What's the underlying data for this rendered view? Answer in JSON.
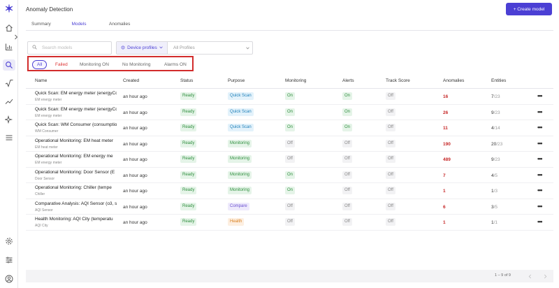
{
  "header": {
    "title": "Anomaly Detection",
    "create_label": "+ Create model"
  },
  "tabs": [
    {
      "label": "Summary"
    },
    {
      "label": "Models"
    },
    {
      "label": "Anomalies"
    }
  ],
  "search": {
    "placeholder": "Search models",
    "value": ""
  },
  "profile_filter": {
    "type_label": "Device profiles",
    "value": "All Profiles"
  },
  "status_filters": [
    {
      "label": "All"
    },
    {
      "label": "Failed"
    },
    {
      "label": "Monitoring ON"
    },
    {
      "label": "No Monitoring"
    },
    {
      "label": "Alarms ON"
    }
  ],
  "columns": [
    "Name",
    "Created",
    "Status",
    "Purpose",
    "Monitoring",
    "Alerts",
    "Track Score",
    "Anomalies",
    "Entities"
  ],
  "rows": [
    {
      "name": "Quick Scan: EM energy meter (energyCo",
      "profile": "EM energy meter",
      "created": "an hour ago",
      "status": "Ready",
      "purpose": "Quick Scan",
      "monitoring": "On",
      "alerts": "On",
      "track": "Off",
      "anomalies": "16",
      "ent_a": "7",
      "ent_b": "/23"
    },
    {
      "name": "Quick Scan: EM energy meter (energyCo",
      "profile": "EM energy meter",
      "created": "an hour ago",
      "status": "Ready",
      "purpose": "Quick Scan",
      "monitoring": "On",
      "alerts": "On",
      "track": "Off",
      "anomalies": "26",
      "ent_a": "9",
      "ent_b": "/23"
    },
    {
      "name": "Quick Scan: WM Consumer (consumptio",
      "profile": "WM Consumer",
      "created": "an hour ago",
      "status": "Ready",
      "purpose": "Quick Scan",
      "monitoring": "On",
      "alerts": "On",
      "track": "Off",
      "anomalies": "11",
      "ent_a": "4",
      "ent_b": "/14"
    },
    {
      "name": "Operational Monitoring: EM heat meter",
      "profile": "EM heat meter",
      "created": "an hour ago",
      "status": "Ready",
      "purpose": "Monitoring",
      "monitoring": "Off",
      "alerts": "Off",
      "track": "Off",
      "anomalies": "190",
      "ent_a": "20",
      "ent_b": "/23"
    },
    {
      "name": "Operational Monitoring: EM energy me",
      "profile": "EM energy meter",
      "created": "an hour ago",
      "status": "Ready",
      "purpose": "Monitoring",
      "monitoring": "Off",
      "alerts": "Off",
      "track": "Off",
      "anomalies": "489",
      "ent_a": "9",
      "ent_b": "/23"
    },
    {
      "name": "Operational Monitoring: Door Sensor (E",
      "profile": "Door Sensor",
      "created": "an hour ago",
      "status": "Ready",
      "purpose": "Monitoring",
      "monitoring": "On",
      "alerts": "Off",
      "track": "Off",
      "anomalies": "7",
      "ent_a": "4",
      "ent_b": "/5"
    },
    {
      "name": "Operational Monitoring: Chiller (tempe",
      "profile": "Chiller",
      "created": "an hour ago",
      "status": "Ready",
      "purpose": "Monitoring",
      "monitoring": "On",
      "alerts": "Off",
      "track": "Off",
      "anomalies": "1",
      "ent_a": "1",
      "ent_b": "/3"
    },
    {
      "name": "Comparative Analysis: AQI Sensor (o3, s",
      "profile": "AQI Sensor",
      "created": "an hour ago",
      "status": "Ready",
      "purpose": "Compare",
      "monitoring": "Off",
      "alerts": "Off",
      "track": "Off",
      "anomalies": "6",
      "ent_a": "3",
      "ent_b": "/5"
    },
    {
      "name": "Health Monitoring: AQI City (temperatu",
      "profile": "AQI City",
      "created": "an hour ago",
      "status": "Ready",
      "purpose": "Health",
      "monitoring": "Off",
      "alerts": "Off",
      "track": "Off",
      "anomalies": "1",
      "ent_a": "1",
      "ent_b": "/1"
    }
  ],
  "pagination": {
    "label": "1 – 9 of 9"
  },
  "more_glyph": "•••",
  "icons": {
    "logo": "snowflake-logo-icon",
    "home": "home-icon",
    "chart": "bar-chart-icon",
    "search": "search-icon",
    "formula": "square-root-icon",
    "trend": "trend-line-icon",
    "sparkle": "sparkle-icon",
    "menu": "menu-icon",
    "settings": "gear-icon",
    "sliders": "sliders-icon",
    "user": "user-icon"
  },
  "colors": {
    "accent": "#4b3fd4",
    "highlight": "#d22c2c",
    "anomaly": "#c62828"
  }
}
